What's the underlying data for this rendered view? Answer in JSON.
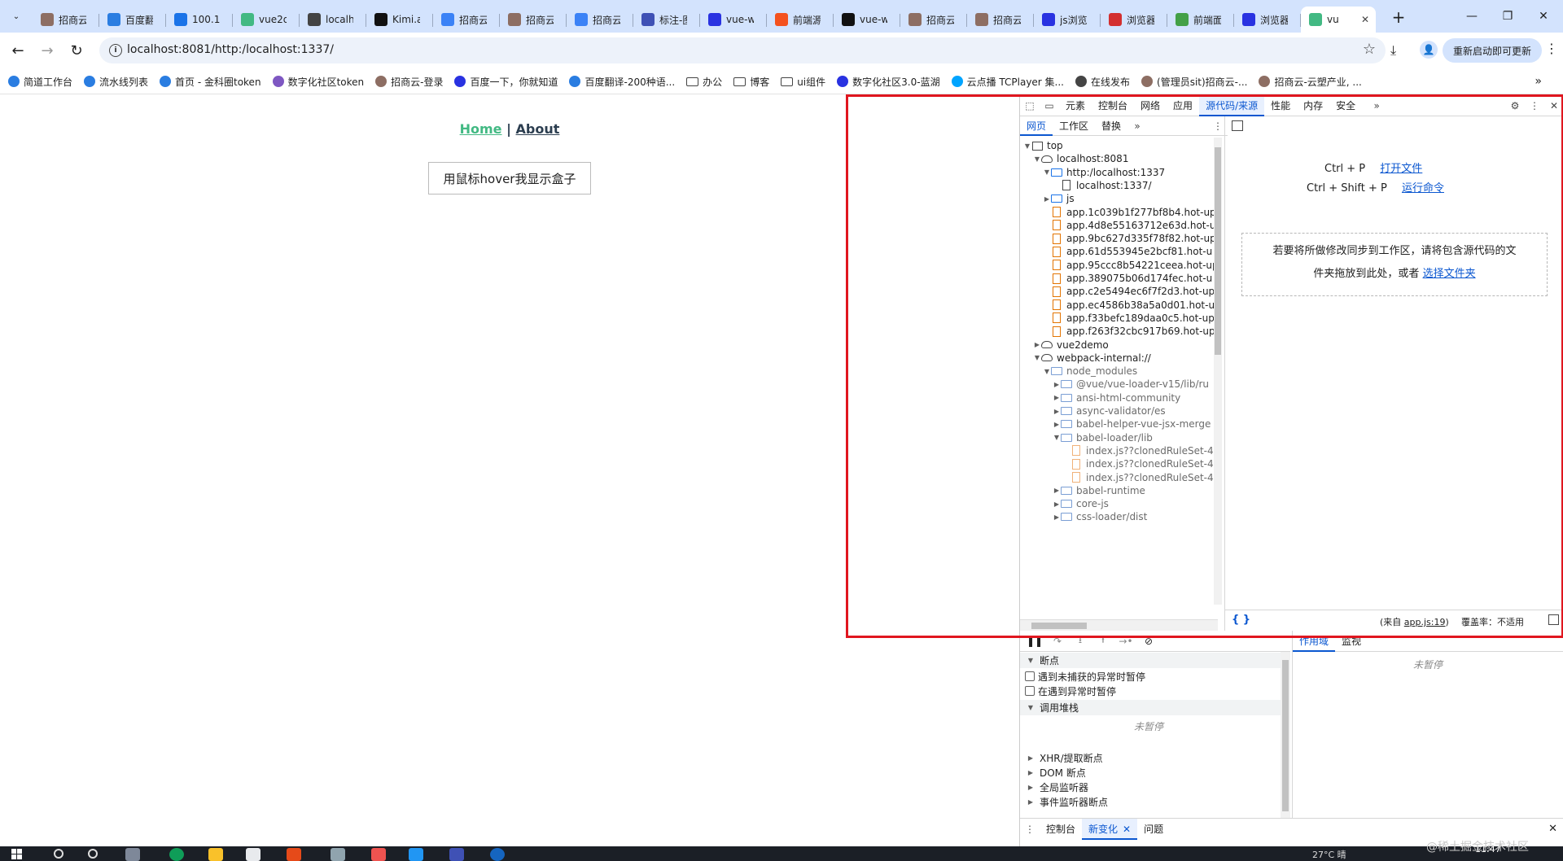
{
  "tabs": [
    {
      "title": "招商云",
      "icon": "icon-rings",
      "color": "#8d6e63"
    },
    {
      "title": "百度翻",
      "icon": "translate-icon",
      "color": "#2a7de1"
    },
    {
      "title": "100.10",
      "icon": "icon-circle",
      "color": "#1a73e8"
    },
    {
      "title": "vue2d",
      "icon": "vue-icon",
      "color": "#42b983"
    },
    {
      "title": "localh",
      "icon": "globe-icon",
      "color": "#444444"
    },
    {
      "title": "Kimi.a",
      "icon": "kimi-icon",
      "color": "#111111"
    },
    {
      "title": "招商云",
      "icon": "icon-cloud-blue",
      "color": "#3b82f6"
    },
    {
      "title": "招商云",
      "icon": "icon-rings",
      "color": "#8d6e63"
    },
    {
      "title": "招商云",
      "icon": "icon-cloud-blue",
      "color": "#3b82f6"
    },
    {
      "title": "标注-图",
      "icon": "label-icon",
      "color": "#3f51b5"
    },
    {
      "title": "vue-w",
      "icon": "baidu-icon",
      "color": "#2932e1"
    },
    {
      "title": "前端源",
      "icon": "c-icon",
      "color": "#f4511e"
    },
    {
      "title": "vue-w",
      "icon": "github-icon",
      "color": "#111111"
    },
    {
      "title": "招商云",
      "icon": "icon-rings",
      "color": "#8d6e63"
    },
    {
      "title": "招商云",
      "icon": "icon-rings",
      "color": "#8d6e63"
    },
    {
      "title": "js浏览",
      "icon": "baidu-icon",
      "color": "#2932e1"
    },
    {
      "title": "浏览器",
      "icon": "51-icon",
      "color": "#d32f2f"
    },
    {
      "title": "前端面",
      "icon": "edit-icon",
      "color": "#43a047"
    },
    {
      "title": "浏览器",
      "icon": "baidu-icon",
      "color": "#2932e1"
    },
    {
      "title": "vu",
      "icon": "vue-icon",
      "color": "#42b983",
      "active": true
    }
  ],
  "toolbar": {
    "url": "localhost:8081/http:/localhost:1337/",
    "relaunch_label": "重新启动即可更新"
  },
  "bookmarks": [
    {
      "label": "简道工作台",
      "icon": "bookmark-app-icon",
      "color": "#2a7de1"
    },
    {
      "label": "流水线列表",
      "icon": "bookmark-app-icon",
      "color": "#2a7de1"
    },
    {
      "label": "首页 - 金科圈token",
      "icon": "bookmark-app-icon",
      "color": "#2a7de1"
    },
    {
      "label": "数字化社区token",
      "icon": "bookmark-app-icon",
      "color": "#7e57c2"
    },
    {
      "label": "招商云-登录",
      "icon": "bookmark-app-icon",
      "color": "#8d6e63"
    },
    {
      "label": "百度一下，你就知道",
      "icon": "baidu-icon",
      "color": "#2932e1"
    },
    {
      "label": "百度翻译-200种语...",
      "icon": "translate-icon",
      "color": "#2a7de1"
    },
    {
      "label": "办公",
      "icon": "folder-icon",
      "folder": true
    },
    {
      "label": "博客",
      "icon": "folder-icon",
      "folder": true
    },
    {
      "label": "ui组件",
      "icon": "folder-icon",
      "folder": true
    },
    {
      "label": "数字化社区3.0-蓝湖",
      "icon": "bookmark-app-icon",
      "color": "#2932e1"
    },
    {
      "label": "云点播 TCPlayer 集...",
      "icon": "bookmark-app-icon",
      "color": "#00a4ff"
    },
    {
      "label": "在线发布",
      "icon": "globe-icon",
      "color": "#444444"
    },
    {
      "label": "(管理员sit)招商云-...",
      "icon": "bookmark-app-icon",
      "color": "#8d6e63"
    },
    {
      "label": "招商云-云塑产业, ...",
      "icon": "bookmark-app-icon",
      "color": "#8d6e63"
    }
  ],
  "page": {
    "home_link": "Home",
    "separator": "|",
    "about_link": "About",
    "hover_button": "用鼠标hover我显示盒子"
  },
  "devtools": {
    "main_tabs": [
      "元素",
      "控制台",
      "网络",
      "应用",
      "源代码/来源",
      "性能",
      "内存",
      "安全"
    ],
    "active_main_tab": "源代码/来源",
    "nav_tabs": [
      "网页",
      "工作区",
      "替换"
    ],
    "tree": [
      {
        "label": "top",
        "icon": "frame",
        "indent": 0,
        "arrow": "▼"
      },
      {
        "label": "localhost:8081",
        "icon": "cloud",
        "indent": 1,
        "arrow": "▼"
      },
      {
        "label": "http:/localhost:1337",
        "icon": "folder",
        "indent": 2,
        "arrow": "▼"
      },
      {
        "label": "localhost:1337/",
        "icon": "doc",
        "indent": 3,
        "arrow": ""
      },
      {
        "label": "js",
        "icon": "folder",
        "indent": 2,
        "arrow": "▶"
      },
      {
        "label": "app.1c039b1f277bf8b4.hot-up",
        "icon": "js",
        "indent": 2,
        "arrow": ""
      },
      {
        "label": "app.4d8e55163712e63d.hot-u",
        "icon": "js",
        "indent": 2,
        "arrow": ""
      },
      {
        "label": "app.9bc627d335f78f82.hot-up",
        "icon": "js",
        "indent": 2,
        "arrow": ""
      },
      {
        "label": "app.61d553945e2bcf81.hot-u",
        "icon": "js",
        "indent": 2,
        "arrow": ""
      },
      {
        "label": "app.95ccc8b54221ceea.hot-up",
        "icon": "js",
        "indent": 2,
        "arrow": ""
      },
      {
        "label": "app.389075b06d174fec.hot-u",
        "icon": "js",
        "indent": 2,
        "arrow": ""
      },
      {
        "label": "app.c2e5494ec6f7f2d3.hot-up",
        "icon": "js",
        "indent": 2,
        "arrow": ""
      },
      {
        "label": "app.ec4586b38a5a0d01.hot-u",
        "icon": "js",
        "indent": 2,
        "arrow": ""
      },
      {
        "label": "app.f33befc189daa0c5.hot-up",
        "icon": "js",
        "indent": 2,
        "arrow": ""
      },
      {
        "label": "app.f263f32cbc917b69.hot-up",
        "icon": "js",
        "indent": 2,
        "arrow": ""
      },
      {
        "label": "vue2demo",
        "icon": "cloud",
        "indent": 1,
        "arrow": "▶"
      },
      {
        "label": "webpack-internal://",
        "icon": "cloud",
        "indent": 1,
        "arrow": "▼"
      },
      {
        "label": "node_modules",
        "icon": "folder",
        "indent": 2,
        "arrow": "▼",
        "dim": true
      },
      {
        "label": "@vue/vue-loader-v15/lib/ru",
        "icon": "folder",
        "indent": 3,
        "arrow": "▶",
        "dim": true
      },
      {
        "label": "ansi-html-community",
        "icon": "folder",
        "indent": 3,
        "arrow": "▶",
        "dim": true
      },
      {
        "label": "async-validator/es",
        "icon": "folder",
        "indent": 3,
        "arrow": "▶",
        "dim": true
      },
      {
        "label": "babel-helper-vue-jsx-merge",
        "icon": "folder",
        "indent": 3,
        "arrow": "▶",
        "dim": true
      },
      {
        "label": "babel-loader/lib",
        "icon": "folder",
        "indent": 3,
        "arrow": "▼",
        "dim": true
      },
      {
        "label": "index.js??clonedRuleSet-4",
        "icon": "js",
        "indent": 4,
        "arrow": "",
        "dim": true
      },
      {
        "label": "index.js??clonedRuleSet-4",
        "icon": "js",
        "indent": 4,
        "arrow": "",
        "dim": true
      },
      {
        "label": "index.js??clonedRuleSet-4",
        "icon": "js",
        "indent": 4,
        "arrow": "",
        "dim": true
      },
      {
        "label": "babel-runtime",
        "icon": "folder",
        "indent": 3,
        "arrow": "▶",
        "dim": true
      },
      {
        "label": "core-js",
        "icon": "folder",
        "indent": 3,
        "arrow": "▶",
        "dim": true
      },
      {
        "label": "css-loader/dist",
        "icon": "folder",
        "indent": 3,
        "arrow": "▶",
        "dim": true
      }
    ],
    "editor": {
      "shortcut1_keys": "Ctrl + P",
      "shortcut1_action": "打开文件",
      "shortcut2_keys": "Ctrl + Shift + P",
      "shortcut2_action": "运行命令",
      "drop_text_1": "若要将所做修改同步到工作区，请将包含源代码的文",
      "drop_text_2": "件夹拖放到此处，或者",
      "drop_link": "选择文件夹",
      "status_source_prefix": "(来自",
      "status_source_file": "app.js:19",
      "status_source_suffix": ")",
      "status_coverage": "覆盖率：不适用"
    },
    "debugger": {
      "breakpoints_title": "断点",
      "pause_uncaught": "遇到未捕获的异常时暂停",
      "pause_caught": "在遇到异常时暂停",
      "callstack_title": "调用堆栈",
      "not_paused": "未暂停",
      "sections": [
        "XHR/提取断点",
        "DOM 断点",
        "全局监听器",
        "事件监听器断点"
      ],
      "scope_tabs": [
        "作用域",
        "监视"
      ],
      "scope_not_paused": "未暂停"
    },
    "drawer": {
      "tabs": [
        "控制台",
        "新变化",
        "问题"
      ],
      "active": "新变化"
    }
  },
  "taskbar": {
    "tray_text": "27°C 晴",
    "clock": "11:47"
  },
  "watermark": "@稀土掘金技术社区",
  "highlight_color": "#e0161f"
}
